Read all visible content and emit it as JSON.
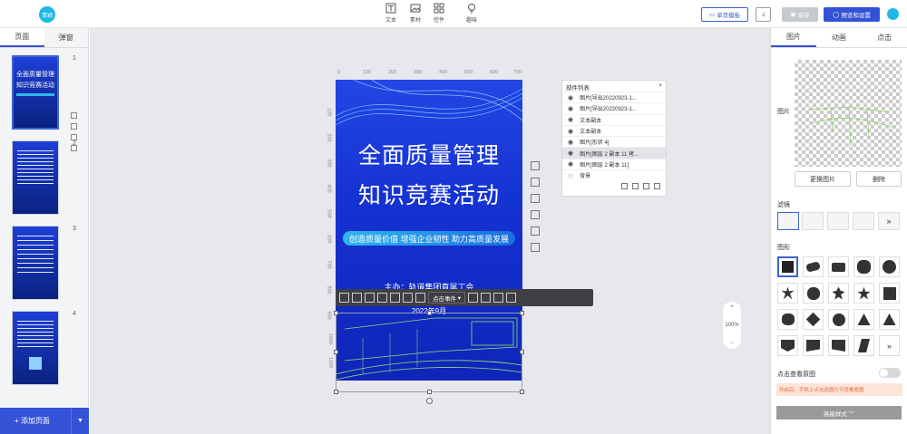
{
  "app": {
    "logo_text": "青颖"
  },
  "toolbar": {
    "tools": [
      {
        "label": "文本",
        "icon": "text-icon"
      },
      {
        "label": "素材",
        "icon": "image-icon"
      },
      {
        "label": "控件",
        "icon": "widget-icon"
      },
      {
        "label": "趣味",
        "icon": "bulb-icon"
      }
    ],
    "single_template": "单页模板",
    "music_icon": "music-icon",
    "save": "保存",
    "preview_settings": "预览和设置"
  },
  "left_panel": {
    "tabs": [
      "页面",
      "弹窗"
    ],
    "active_tab": 0,
    "pages": [
      {
        "number": "1",
        "title_line1": "全面质量管理",
        "title_line2": "知识竞赛活动"
      },
      {
        "number": "2"
      },
      {
        "number": "3"
      },
      {
        "number": "4"
      }
    ],
    "add_page": "+ 添加页面",
    "add_page_caret": "▼"
  },
  "canvas": {
    "ruler_top": [
      "0",
      "100",
      "200",
      "300",
      "400",
      "500",
      "600",
      "700"
    ],
    "ruler_left": [
      "100",
      "200",
      "300",
      "400",
      "500",
      "600",
      "700",
      "800",
      "900",
      "1000",
      "1100"
    ],
    "poster": {
      "title_line1": "全面质量管理",
      "title_line2": "知识竞赛活动",
      "slogan": "创造质量价值  增强企业韧性  助力高质量发展",
      "host": "主办：轨道集团直属工会",
      "date": "2022年9月"
    },
    "context_toolbar": {
      "event_label": "点击事件"
    },
    "zoom": {
      "plus": "+",
      "value": "100%",
      "minus": "−"
    }
  },
  "component_list": {
    "title": "部件列表",
    "close": "×",
    "items": [
      {
        "label": "图片[导出20220923-1...",
        "visible": true,
        "selected": false
      },
      {
        "label": "图片[导出20220923-1...",
        "visible": true,
        "selected": false
      },
      {
        "label": "文本副本",
        "visible": true,
        "selected": false
      },
      {
        "label": "文本副本",
        "visible": true,
        "selected": false
      },
      {
        "label": "图片[形状 4]",
        "visible": true,
        "selected": false
      },
      {
        "label": "图片[图层 2 副本 11 拷...",
        "visible": true,
        "selected": true
      },
      {
        "label": "图片[图层 2 副本 11]",
        "visible": true,
        "selected": false
      },
      {
        "label": "背景",
        "visible": false,
        "selected": false
      }
    ]
  },
  "right_panel": {
    "tabs": [
      "图片",
      "动画",
      "点击"
    ],
    "active_tab": 0,
    "image_label": "图片",
    "replace_image": "更换图片",
    "delete": "删除",
    "filter_label": "滤镜",
    "shape_label": "图形",
    "more": "»",
    "click_view_label": "点击查看原图",
    "notice": "开启后，手机上点击此图片可查看原图",
    "advanced": "高级样式 ﹀"
  },
  "colors": {
    "accent": "#3452d6",
    "poster_blue": "#1532d2",
    "notice_bg": "#fde4d8",
    "notice_text": "#e8673c"
  }
}
